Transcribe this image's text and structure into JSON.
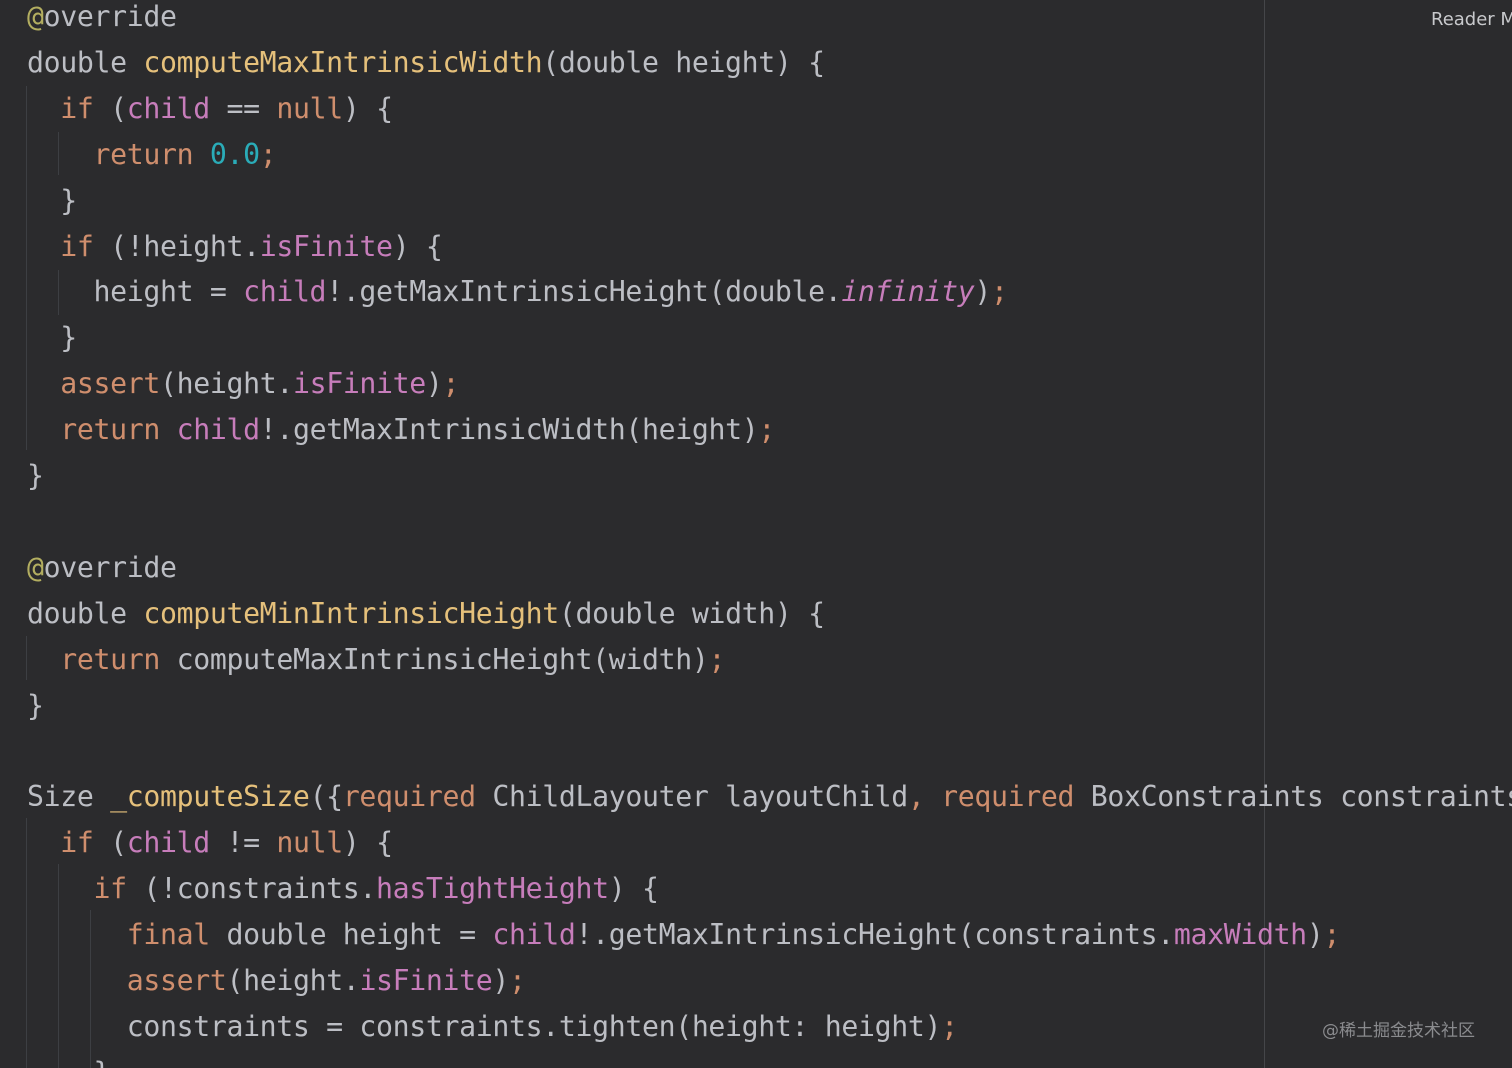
{
  "editor": {
    "reader_mode_label": "Reader M",
    "watermark": "@稀土掘金技术社区"
  },
  "code": [
    [
      {
        "t": "@",
        "c": "a"
      },
      {
        "t": "override",
        "c": "t"
      }
    ],
    [
      {
        "t": "double ",
        "c": "t"
      },
      {
        "t": "computeMaxIntrinsicWidth",
        "c": "f"
      },
      {
        "t": "(double height) {",
        "c": "t"
      }
    ],
    [
      {
        "t": "  ",
        "c": "t"
      },
      {
        "t": "if",
        "c": "k"
      },
      {
        "t": " (",
        "c": "t"
      },
      {
        "t": "child",
        "c": "p"
      },
      {
        "t": " == ",
        "c": "t"
      },
      {
        "t": "null",
        "c": "k"
      },
      {
        "t": ") {",
        "c": "t"
      }
    ],
    [
      {
        "t": "    ",
        "c": "t"
      },
      {
        "t": "return",
        "c": "k"
      },
      {
        "t": " ",
        "c": "t"
      },
      {
        "t": "0.0",
        "c": "num"
      },
      {
        "t": ";",
        "c": "k"
      }
    ],
    [
      {
        "t": "  }",
        "c": "t"
      }
    ],
    [
      {
        "t": "  ",
        "c": "t"
      },
      {
        "t": "if",
        "c": "k"
      },
      {
        "t": " (!height.",
        "c": "t"
      },
      {
        "t": "isFinite",
        "c": "p"
      },
      {
        "t": ") {",
        "c": "t"
      }
    ],
    [
      {
        "t": "    height = ",
        "c": "t"
      },
      {
        "t": "child",
        "c": "p"
      },
      {
        "t": "!.getMaxIntrinsicHeight(double.",
        "c": "t"
      },
      {
        "t": "infinity",
        "c": "i"
      },
      {
        "t": ")",
        "c": "t"
      },
      {
        "t": ";",
        "c": "k"
      }
    ],
    [
      {
        "t": "  }",
        "c": "t"
      }
    ],
    [
      {
        "t": "  ",
        "c": "t"
      },
      {
        "t": "assert",
        "c": "k"
      },
      {
        "t": "(height.",
        "c": "t"
      },
      {
        "t": "isFinite",
        "c": "p"
      },
      {
        "t": ")",
        "c": "t"
      },
      {
        "t": ";",
        "c": "k"
      }
    ],
    [
      {
        "t": "  ",
        "c": "t"
      },
      {
        "t": "return",
        "c": "k"
      },
      {
        "t": " ",
        "c": "t"
      },
      {
        "t": "child",
        "c": "p"
      },
      {
        "t": "!.getMaxIntrinsicWidth(height)",
        "c": "t"
      },
      {
        "t": ";",
        "c": "k"
      }
    ],
    [
      {
        "t": "}",
        "c": "t"
      }
    ],
    [],
    [
      {
        "t": "@",
        "c": "a"
      },
      {
        "t": "override",
        "c": "t"
      }
    ],
    [
      {
        "t": "double ",
        "c": "t"
      },
      {
        "t": "computeMinIntrinsicHeight",
        "c": "f"
      },
      {
        "t": "(double width) {",
        "c": "t"
      }
    ],
    [
      {
        "t": "  ",
        "c": "t"
      },
      {
        "t": "return",
        "c": "k"
      },
      {
        "t": " computeMaxIntrinsicHeight(width)",
        "c": "t"
      },
      {
        "t": ";",
        "c": "k"
      }
    ],
    [
      {
        "t": "}",
        "c": "t"
      }
    ],
    [],
    [
      {
        "t": "Size ",
        "c": "t"
      },
      {
        "t": "_computeSize",
        "c": "f"
      },
      {
        "t": "({",
        "c": "t"
      },
      {
        "t": "required",
        "c": "k"
      },
      {
        "t": " ChildLayouter layoutChild",
        "c": "t"
      },
      {
        "t": ", ",
        "c": "k"
      },
      {
        "t": "required",
        "c": "k"
      },
      {
        "t": " BoxConstraints constraints}) {",
        "c": "t"
      }
    ],
    [
      {
        "t": "  ",
        "c": "t"
      },
      {
        "t": "if",
        "c": "k"
      },
      {
        "t": " (",
        "c": "t"
      },
      {
        "t": "child",
        "c": "p"
      },
      {
        "t": " != ",
        "c": "t"
      },
      {
        "t": "null",
        "c": "k"
      },
      {
        "t": ") {",
        "c": "t"
      }
    ],
    [
      {
        "t": "    ",
        "c": "t"
      },
      {
        "t": "if",
        "c": "k"
      },
      {
        "t": " (!constraints.",
        "c": "t"
      },
      {
        "t": "hasTightHeight",
        "c": "p"
      },
      {
        "t": ") {",
        "c": "t"
      }
    ],
    [
      {
        "t": "      ",
        "c": "t"
      },
      {
        "t": "final",
        "c": "k"
      },
      {
        "t": " double height = ",
        "c": "t"
      },
      {
        "t": "child",
        "c": "p"
      },
      {
        "t": "!.getMaxIntrinsicHeight(constraints.",
        "c": "t"
      },
      {
        "t": "maxWidth",
        "c": "p"
      },
      {
        "t": ")",
        "c": "t"
      },
      {
        "t": ";",
        "c": "k"
      }
    ],
    [
      {
        "t": "      ",
        "c": "t"
      },
      {
        "t": "assert",
        "c": "k"
      },
      {
        "t": "(height.",
        "c": "t"
      },
      {
        "t": "isFinite",
        "c": "p"
      },
      {
        "t": ")",
        "c": "t"
      },
      {
        "t": ";",
        "c": "k"
      }
    ],
    [
      {
        "t": "      constraints = constraints.tighten(height: height)",
        "c": "t"
      },
      {
        "t": ";",
        "c": "k"
      }
    ],
    [
      {
        "t": "    }",
        "c": "t"
      }
    ]
  ]
}
